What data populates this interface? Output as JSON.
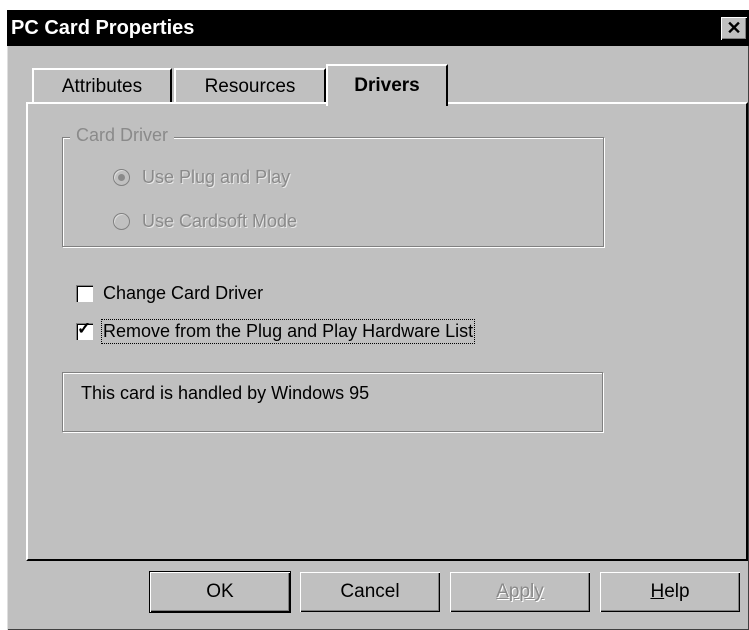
{
  "window": {
    "title": "PC Card Properties",
    "close_glyph": "✕"
  },
  "tabs": [
    {
      "label": "Attributes",
      "active": false
    },
    {
      "label": "Resources",
      "active": false
    },
    {
      "label": "Drivers",
      "active": true
    }
  ],
  "card_driver": {
    "legend": "Card Driver",
    "options": [
      {
        "label": "Use Plug and Play",
        "selected": true,
        "enabled": false
      },
      {
        "label": "Use Cardsoft Mode",
        "selected": false,
        "enabled": false
      }
    ]
  },
  "checkboxes": [
    {
      "label": "Change Card Driver",
      "checked": false
    },
    {
      "label": "Remove from the Plug and Play Hardware List",
      "checked": true,
      "check_glyph": "✓"
    }
  ],
  "info_text": "This card is handled by Windows 95",
  "buttons": {
    "ok": "OK",
    "cancel": "Cancel",
    "apply": "Apply",
    "apply_enabled": false,
    "help_accel": "H",
    "help_rest": "elp"
  }
}
